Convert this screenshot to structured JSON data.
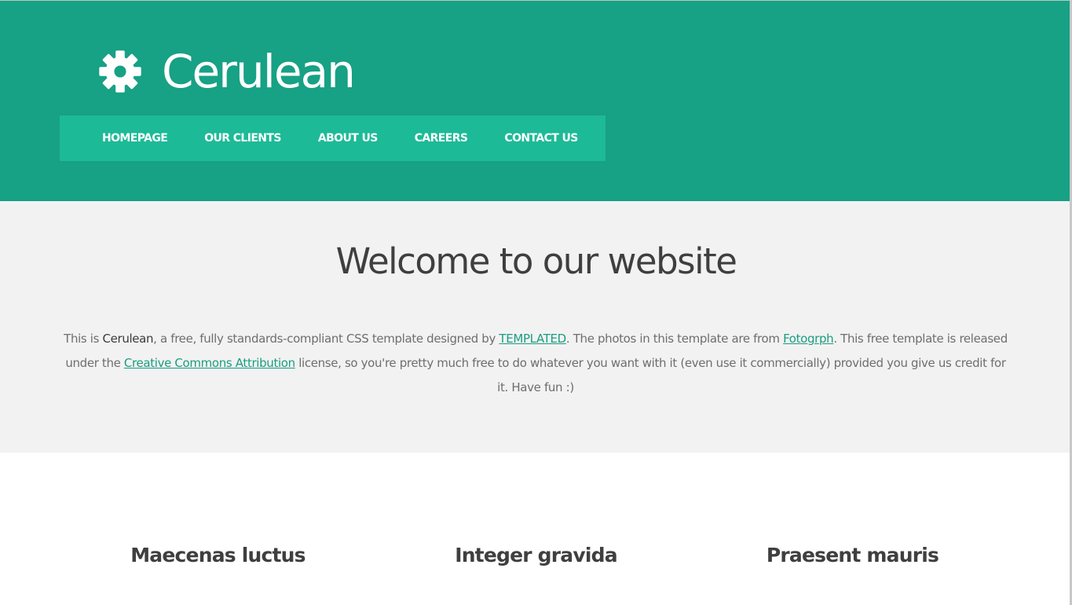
{
  "header": {
    "logo_icon": "gear-icon",
    "site_title": "Cerulean",
    "colors": {
      "header_bg": "#17a185",
      "nav_bg": "#1dba97",
      "text": "#ffffff"
    }
  },
  "nav": {
    "items": [
      {
        "label": "HOMEPAGE"
      },
      {
        "label": "OUR CLIENTS"
      },
      {
        "label": "ABOUT US"
      },
      {
        "label": "CAREERS"
      },
      {
        "label": "CONTACT US"
      }
    ]
  },
  "welcome": {
    "title": "Welcome to our website",
    "text": {
      "p1": "This is ",
      "brand": "Cerulean",
      "p2": ", a free, fully standards-compliant CSS template designed by ",
      "link1": "TEMPLATED",
      "p3": ". The photos in this template are from ",
      "link2": "Fotogrph",
      "p4": ". This free template is released under the ",
      "link3": "Creative Commons Attribution",
      "p5": " license, so you're pretty much free to do whatever you want with it (even use it commercially) provided you give us credit for it. Have fun :)"
    },
    "colors": {
      "bg": "#f2f2f2",
      "link": "#1a9d80"
    }
  },
  "features": {
    "titles": [
      "Maecenas luctus",
      "Integer gravida",
      "Praesent mauris"
    ]
  }
}
